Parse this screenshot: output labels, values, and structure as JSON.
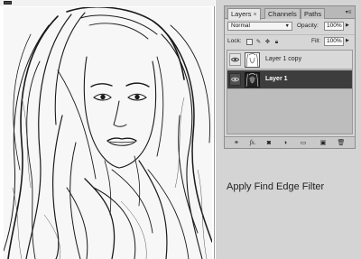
{
  "layers_panel": {
    "tabs": [
      {
        "label": "Layers",
        "active": true,
        "close": "×"
      },
      {
        "label": "Channels",
        "active": false
      },
      {
        "label": "Paths",
        "active": false
      }
    ],
    "blend_mode": "Normal",
    "opacity_label": "Opacity:",
    "opacity_value": "100%",
    "lock_label": "Lock:",
    "fill_label": "Fill:",
    "fill_value": "100%",
    "layers": [
      {
        "name": "Layer 1 copy",
        "visible": true,
        "selected": false
      },
      {
        "name": "Layer 1",
        "visible": true,
        "selected": true
      }
    ],
    "footer_icons": [
      "link-icon",
      "fx-icon",
      "mask-icon",
      "adjustment-icon",
      "group-folder-icon",
      "new-layer-icon",
      "trash-icon"
    ],
    "footer_labels": {
      "fx": "fx."
    }
  },
  "caption": "Apply Find Edge Filter",
  "colors": {
    "panel_bg": "#d6d6d6",
    "selected_layer": "#3d3d3d",
    "side_bg": "#d4d4d4"
  }
}
